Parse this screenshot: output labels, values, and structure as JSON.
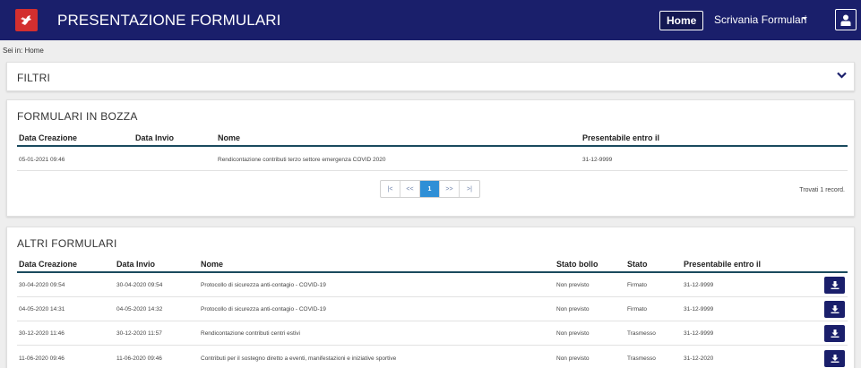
{
  "header": {
    "title": "PRESENTAZIONE FORMULARI",
    "nav_home": "Home",
    "nav_scrivania": "Scrivania Formulari"
  },
  "breadcrumb": "Sei in: Home",
  "filters": {
    "title": "FILTRI"
  },
  "bozza": {
    "title": "FORMULARI IN BOZZA",
    "columns": [
      "Data Creazione",
      "Data Invio",
      "Nome",
      "Presentabile entro il"
    ],
    "rows": [
      {
        "created": "05-01-2021 09:46",
        "sent": "",
        "name": "Rendicontazione contributi terzo settore emergenza COVID 2020",
        "deadline": "31-12-9999"
      }
    ],
    "pager": {
      "first": "|<",
      "prev": "<<",
      "current": "1",
      "next": ">>",
      "last": ">|"
    },
    "found": "Trovati 1 record."
  },
  "altri": {
    "title": "ALTRI FORMULARI",
    "columns": [
      "Data Creazione",
      "Data Invio",
      "Nome",
      "Stato bollo",
      "Stato",
      "Presentabile entro il"
    ],
    "rows": [
      {
        "created": "30-04-2020 09:54",
        "sent": "30-04-2020 09:54",
        "name": "Protocollo di sicurezza anti-contagio - COVID-19",
        "bollo": "Non previsto",
        "stato": "Firmato",
        "deadline": "31-12-9999"
      },
      {
        "created": "04-05-2020 14:31",
        "sent": "04-05-2020 14:32",
        "name": "Protocollo di sicurezza anti-contagio - COVID-19",
        "bollo": "Non previsto",
        "stato": "Firmato",
        "deadline": "31-12-9999"
      },
      {
        "created": "30-12-2020 11:46",
        "sent": "30-12-2020 11:57",
        "name": "Rendicontazione contributi centri estivi",
        "bollo": "Non previsto",
        "stato": "Trasmesso",
        "deadline": "31-12-9999"
      },
      {
        "created": "11-06-2020 09:46",
        "sent": "11-06-2020 09:46",
        "name": "Contributi per il sostegno diretto a eventi, manifestazioni e iniziative sportive",
        "bollo": "Non previsto",
        "stato": "Trasmesso",
        "deadline": "31-12-2020"
      }
    ]
  },
  "icons": {
    "download": "download-icon",
    "user": "user-icon",
    "chevron": "chevron-down-icon",
    "logo": "region-logo"
  },
  "colors": {
    "navbar": "#1a1f6b",
    "accent": "#2f8fd6",
    "header_rule": "#1a4a5e",
    "logo": "#d32f2f"
  }
}
